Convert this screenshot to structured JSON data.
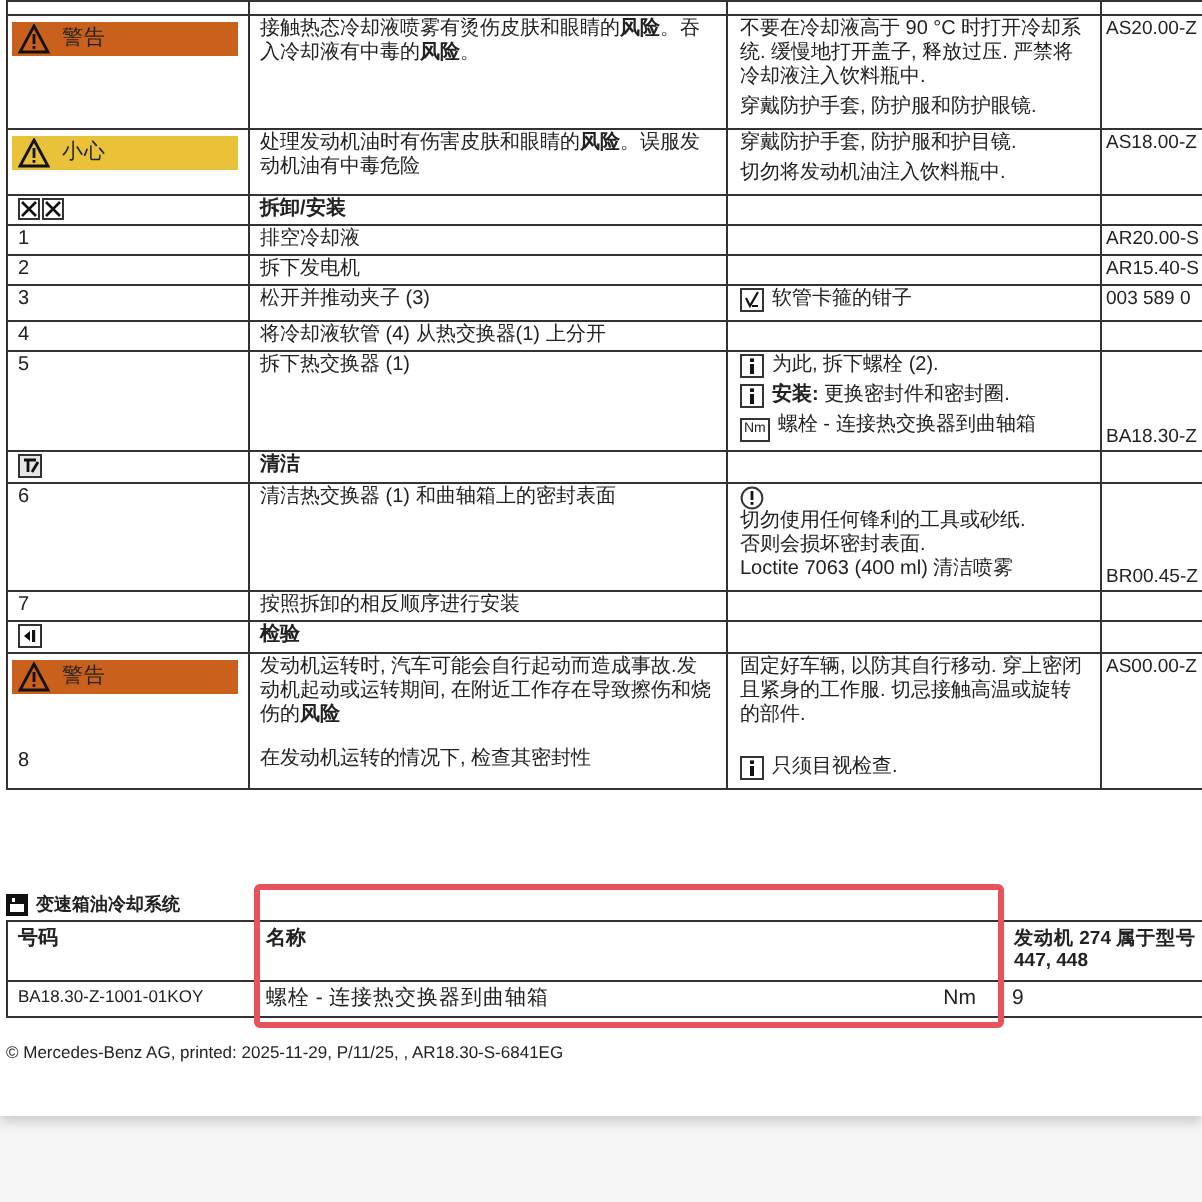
{
  "procedure": {
    "rows": [
      {
        "kind": "step",
        "badge": {
          "label": "警告",
          "color": "#c9611c"
        },
        "text": [
          "接触热态冷却液喷雾有烫伤皮肤和眼睛的**风险**。吞入冷却液有中毒的**风险**。"
        ],
        "notes": [
          {
            "kind": "text",
            "text": "不要在冷却液高于 90 °C 时打开冷却系统. 缓慢地打开盖子, 释放过压. 严禁将冷却液注入饮料瓶中."
          },
          {
            "kind": "text",
            "text": "穿戴防护手套, 防护服和防护眼镜."
          }
        ],
        "ref": "AS20.00-Z"
      },
      {
        "kind": "step",
        "badge": {
          "label": "小心",
          "color": "#e9c23a"
        },
        "text": [
          "处理发动机油时有伤害皮肤和眼睛的**风险**。误服发动机油有中毒危险"
        ],
        "notes": [
          {
            "kind": "text",
            "text": "穿戴防护手套, 防护服和护目镜."
          },
          {
            "kind": "text",
            "text": "切勿将发动机油注入饮料瓶中."
          }
        ],
        "ref": "AS18.00-Z"
      },
      {
        "kind": "remove-install",
        "title": "拆卸/安装"
      },
      {
        "kind": "step",
        "number": "1",
        "text": [
          "排空冷却液"
        ],
        "ref": "AR20.00-S"
      },
      {
        "kind": "step",
        "number": "2",
        "text": [
          "拆下发电机"
        ],
        "ref": "AR15.40-S"
      },
      {
        "kind": "step",
        "number": "3",
        "text": [
          "松开并推动夹子 (3)"
        ],
        "notes": [
          {
            "kind": "tool",
            "text": "软管卡箍的钳子"
          }
        ],
        "ref": "003 589 0"
      },
      {
        "kind": "step",
        "number": "4",
        "text": [
          "将冷却液软管 (4) 从热交换器(1) 上分开"
        ]
      },
      {
        "kind": "step",
        "number": "5",
        "text": [
          "拆下热交换器 (1)"
        ],
        "notes": [
          {
            "kind": "info",
            "text": "为此, 拆下螺栓 (2)."
          },
          {
            "kind": "info",
            "text": "**安装:** 更换密封件和密封圈."
          },
          {
            "kind": "torque",
            "tag": "Nm",
            "text": "螺栓 - 连接热交换器到曲轴箱"
          }
        ],
        "ref": "BA18.30-Z"
      },
      {
        "kind": "clean",
        "title": "清洁"
      },
      {
        "kind": "step",
        "number": "6",
        "text": [
          "清洁热交换器 (1) 和曲轴箱上的密封表面"
        ],
        "notes": [
          {
            "kind": "notice",
            "lines": [
              "切勿使用任何锋利的工具或砂纸.",
              "否则会损坏密封表面.",
              "Loctite 7063 (400 ml) 清洁喷雾"
            ]
          }
        ],
        "ref": "BR00.45-Z"
      },
      {
        "kind": "step",
        "number": "7",
        "text": [
          "按照拆卸的相反顺序进行安装"
        ]
      },
      {
        "kind": "check",
        "title": "检验"
      },
      {
        "kind": "step",
        "badge": {
          "label": "警告",
          "color": "#c9611c"
        },
        "number": "8",
        "text": [
          "发动机运转时, 汽车可能会自行起动而造成事故.发动机起动或运转期间, 在附近工作存在导致擦伤和烧伤的**风险**",
          "在发动机运转的情况下, 检查其密封性"
        ],
        "notes": [
          {
            "kind": "text",
            "text": "固定好车辆, 以防其自行移动. 穿上密闭且紧身的工作服. 切忌接触高温或旋转的部件."
          },
          {
            "kind": "info",
            "text": "只须目视检查."
          }
        ],
        "ref": "AS00.00-Z"
      }
    ]
  },
  "torque_table": {
    "title": "变速箱油冷却系统",
    "columns": [
      "号码",
      "名称",
      "发动机 274 属于型号 447, 448"
    ],
    "rows": [
      {
        "number": "BA18.30-Z-1001-01KOY",
        "name": "螺栓 - 连接热交换器到曲轴箱",
        "unit": "Nm",
        "value": "9"
      }
    ]
  },
  "footer": "© Mercedes-Benz AG, printed: 2025-11-29, P/11/25, , AR18.30-S-6841EG"
}
